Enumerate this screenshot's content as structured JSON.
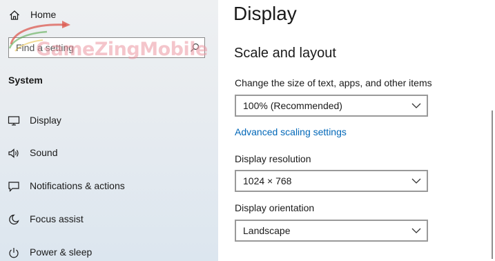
{
  "sidebar": {
    "home_label": "Home",
    "search": {
      "placeholder": "Find a setting"
    },
    "watermark_text": "GameZingMobile",
    "section_title": "System",
    "items": [
      {
        "label": "Display",
        "icon": "monitor-icon"
      },
      {
        "label": "Sound",
        "icon": "speaker-icon"
      },
      {
        "label": "Notifications & actions",
        "icon": "notification-icon"
      },
      {
        "label": "Focus assist",
        "icon": "moon-icon"
      },
      {
        "label": "Power & sleep",
        "icon": "power-icon"
      }
    ]
  },
  "main": {
    "title": "Display",
    "scale_heading": "Scale and layout",
    "scale_label": "Change the size of text, apps, and other items",
    "scale_value": "100% (Recommended)",
    "advanced_link": "Advanced scaling settings",
    "resolution_label": "Display resolution",
    "resolution_value": "1024 × 768",
    "orientation_label": "Display orientation",
    "orientation_value": "Landscape"
  },
  "colors": {
    "link": "#0067b8",
    "dropdown_border": "#999999",
    "watermark": "#eb96a0"
  }
}
